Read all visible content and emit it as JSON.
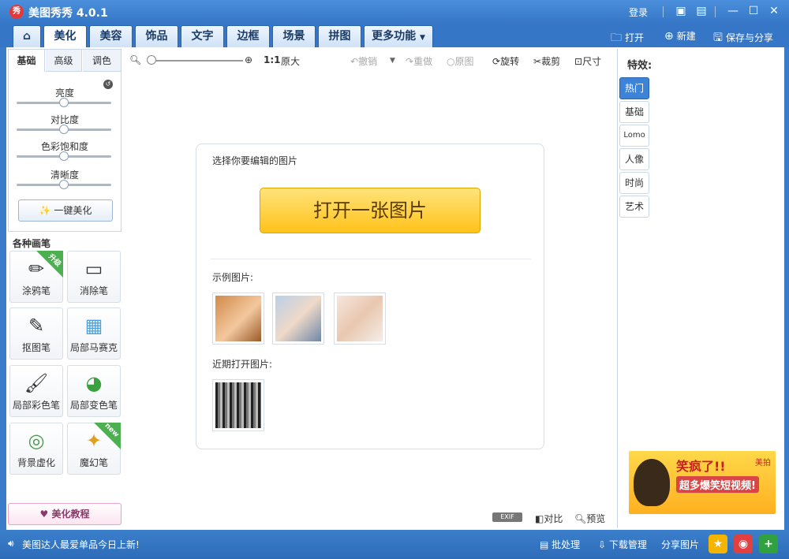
{
  "window": {
    "title": "美图秀秀 4.0.1",
    "logo_char": "秀",
    "login": "登录"
  },
  "tabs": [
    "美化",
    "美容",
    "饰品",
    "文字",
    "边框",
    "场景",
    "拼图",
    "更多功能"
  ],
  "toolbar_right": {
    "open": "打开",
    "new": "新建",
    "save": "保存与分享"
  },
  "adjust": {
    "subtabs": [
      "基础",
      "高级",
      "调色"
    ],
    "sliders": [
      {
        "label": "亮度",
        "value": 0.5
      },
      {
        "label": "对比度",
        "value": 0.5
      },
      {
        "label": "色彩饱和度",
        "value": 0.5
      },
      {
        "label": "清晰度",
        "value": 0.5
      }
    ],
    "one_key": "一键美化"
  },
  "brushes": {
    "title": "各种画笔",
    "items": [
      {
        "label": "涂鸦笔",
        "icon": "✏",
        "badge": "升级"
      },
      {
        "label": "消除笔",
        "icon": "▭",
        "badge": ""
      },
      {
        "label": "抠图笔",
        "icon": "✎",
        "badge": ""
      },
      {
        "label": "局部马赛克",
        "icon": "▦",
        "badge": ""
      },
      {
        "label": "局部彩色笔",
        "icon": "🖌",
        "badge": ""
      },
      {
        "label": "局部变色笔",
        "icon": "◕",
        "badge": ""
      },
      {
        "label": "背景虚化",
        "icon": "◎",
        "badge": ""
      },
      {
        "label": "魔幻笔",
        "icon": "✦",
        "badge": "new"
      }
    ]
  },
  "tutorial": "美化教程",
  "canvas_tools": {
    "zoom_ratio": "1:1",
    "original_size": "原大",
    "undo": "撤销",
    "redo": "重做",
    "original": "原图",
    "rotate": "旋转",
    "crop": "裁剪",
    "size": "尺寸"
  },
  "card": {
    "choose_label": "选择你要编辑的图片",
    "open_button": "打开一张图片",
    "sample_label": "示例图片:",
    "recent_label": "近期打开图片:"
  },
  "bottom_tools": {
    "exif": "EXIF",
    "compare": "对比",
    "preview": "预览"
  },
  "effects": {
    "title": "特效:",
    "tabs": [
      "热门",
      "基础",
      "Lomo",
      "人像",
      "时尚",
      "艺术"
    ]
  },
  "ad": {
    "headline": "笑疯了!!",
    "sub": "超多爆笑短视频!",
    "brand": "美拍"
  },
  "statusbar": {
    "message": "美图达人最爱单品今日上新!",
    "batch": "批处理",
    "download": "下载管理",
    "share": "分享图片"
  },
  "colors": {
    "accent": "#3577c6",
    "button_yellow": "#ffc21a",
    "active_tab": "#3d84d8"
  }
}
